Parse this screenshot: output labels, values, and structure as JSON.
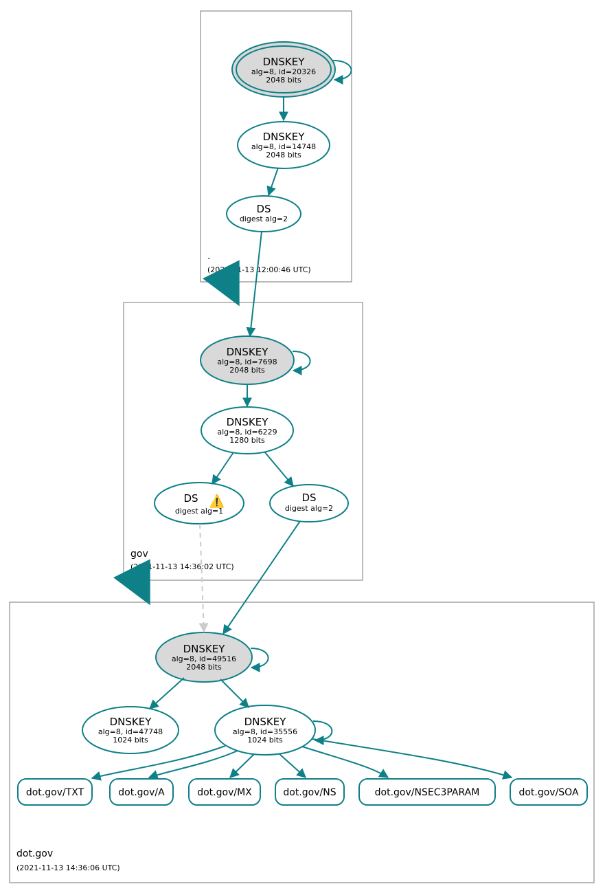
{
  "colors": {
    "stroke": "#0E8088",
    "fill_grey": "#D9D9D9",
    "fill_white": "#FFFFFF",
    "box_stroke": "#777777",
    "dashed": "#CCCCCC"
  },
  "zones": {
    "root": {
      "name": ".",
      "timestamp": "(2021-11-13 12:00:46 UTC)"
    },
    "gov": {
      "name": "gov",
      "timestamp": "(2021-11-13 14:36:02 UTC)"
    },
    "dotgov": {
      "name": "dot.gov",
      "timestamp": "(2021-11-13 14:36:06 UTC)"
    }
  },
  "nodes": {
    "root_ksk": {
      "title": "DNSKEY",
      "line2": "alg=8, id=20326",
      "line3": "2048 bits"
    },
    "root_zsk": {
      "title": "DNSKEY",
      "line2": "alg=8, id=14748",
      "line3": "2048 bits"
    },
    "root_ds": {
      "title": "DS",
      "line2": "digest alg=2"
    },
    "gov_ksk": {
      "title": "DNSKEY",
      "line2": "alg=8, id=7698",
      "line3": "2048 bits"
    },
    "gov_zsk": {
      "title": "DNSKEY",
      "line2": "alg=8, id=6229",
      "line3": "1280 bits"
    },
    "gov_ds1": {
      "title": "DS",
      "line2": "digest alg=1",
      "warning": "⚠️"
    },
    "gov_ds2": {
      "title": "DS",
      "line2": "digest alg=2"
    },
    "dg_ksk": {
      "title": "DNSKEY",
      "line2": "alg=8, id=49516",
      "line3": "2048 bits"
    },
    "dg_zsk_a": {
      "title": "DNSKEY",
      "line2": "alg=8, id=47748",
      "line3": "1024 bits"
    },
    "dg_zsk_b": {
      "title": "DNSKEY",
      "line2": "alg=8, id=35556",
      "line3": "1024 bits"
    }
  },
  "rrsets": {
    "txt": "dot.gov/TXT",
    "a": "dot.gov/A",
    "mx": "dot.gov/MX",
    "ns": "dot.gov/NS",
    "nsec3": "dot.gov/NSEC3PARAM",
    "soa": "dot.gov/SOA"
  }
}
